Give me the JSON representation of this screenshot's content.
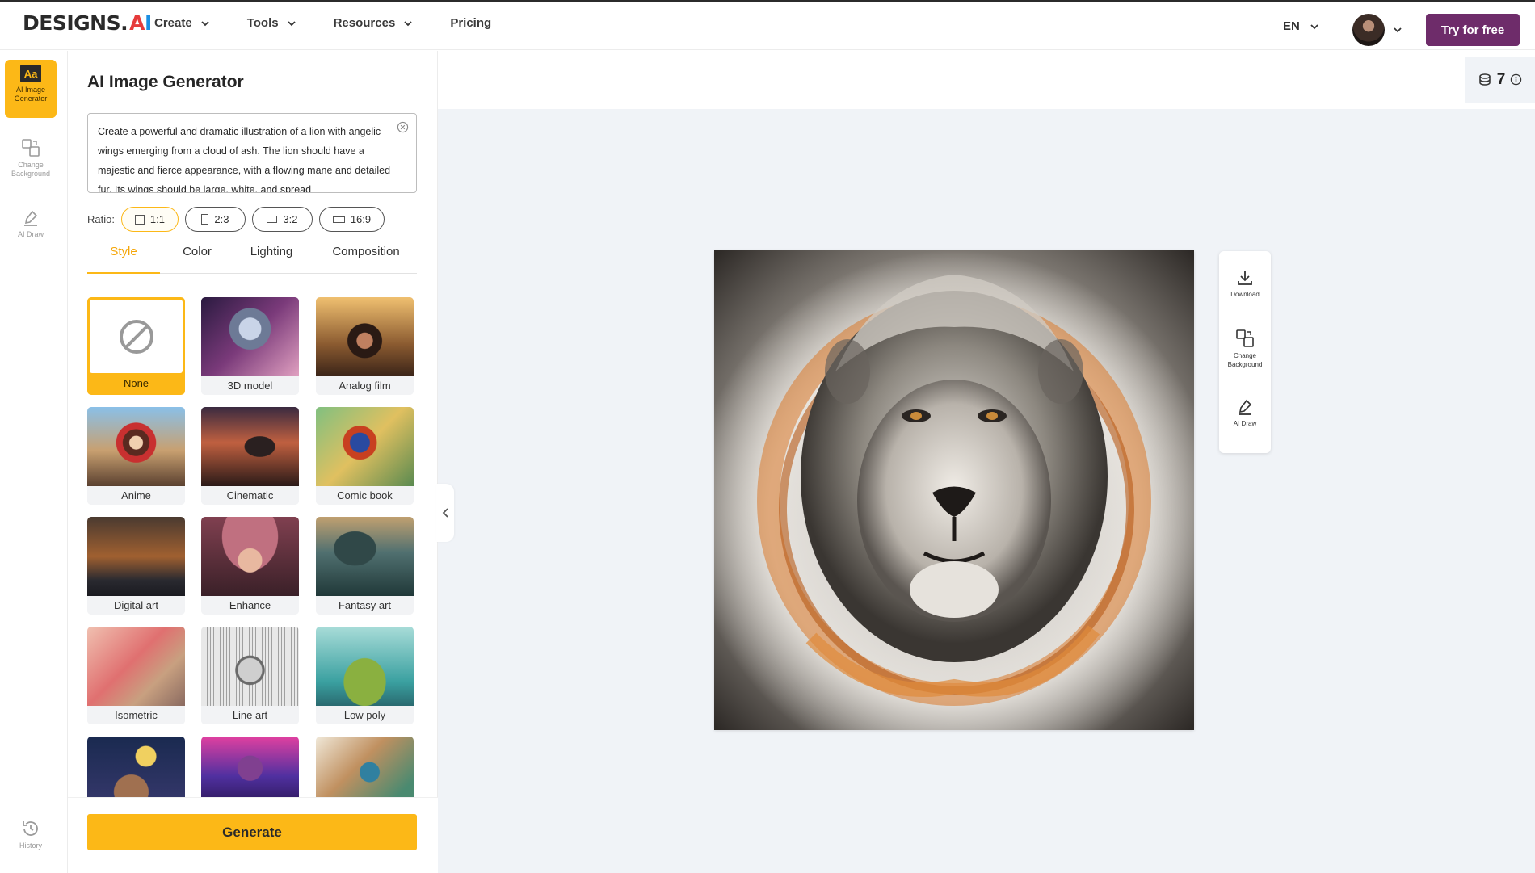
{
  "header": {
    "logo_text": "DESIGNS.",
    "logo_ai_a": "A",
    "logo_ai_i": "I",
    "nav": [
      {
        "label": "Create"
      },
      {
        "label": "Tools"
      },
      {
        "label": "Resources"
      },
      {
        "label": "Pricing"
      }
    ],
    "language": "EN",
    "try_button": "Try for free"
  },
  "rail": {
    "items": [
      {
        "label": "AI Image Generator",
        "icon": "aa-icon",
        "active": true
      },
      {
        "label": "Change Background",
        "icon": "change-background-icon"
      },
      {
        "label": "AI Draw",
        "icon": "ai-draw-icon"
      }
    ],
    "history_label": "History",
    "active_icon_text": "Aa"
  },
  "panel": {
    "title": "AI Image Generator",
    "prompt": "Create a powerful and dramatic illustration of a lion with angelic wings emerging from a cloud of ash. The lion should have a majestic and fierce appearance, with a flowing mane and detailed fur. Its wings should be large, white, and spread",
    "ratio_label": "Ratio:",
    "ratios": [
      "1:1",
      "2:3",
      "3:2",
      "16:9"
    ],
    "selected_ratio": "1:1",
    "tabs": [
      "Style",
      "Color",
      "Lighting",
      "Composition"
    ],
    "active_tab": "Style",
    "styles": [
      "None",
      "3D model",
      "Analog film",
      "Anime",
      "Cinematic",
      "Comic book",
      "Digital art",
      "Enhance",
      "Fantasy art",
      "Isometric",
      "Line art",
      "Low poly",
      "",
      "",
      ""
    ],
    "selected_style": "None",
    "generate_button": "Generate"
  },
  "canvas": {
    "credits": "7",
    "tools": [
      {
        "label": "Download",
        "icon": "download-icon"
      },
      {
        "label": "Change Background",
        "icon": "change-background-icon"
      },
      {
        "label": "AI Draw",
        "icon": "ai-draw-icon"
      }
    ]
  },
  "colors": {
    "accent": "#fcb817",
    "brand_purple": "#6e2c6a",
    "canvas_bg": "#f0f3f7"
  }
}
